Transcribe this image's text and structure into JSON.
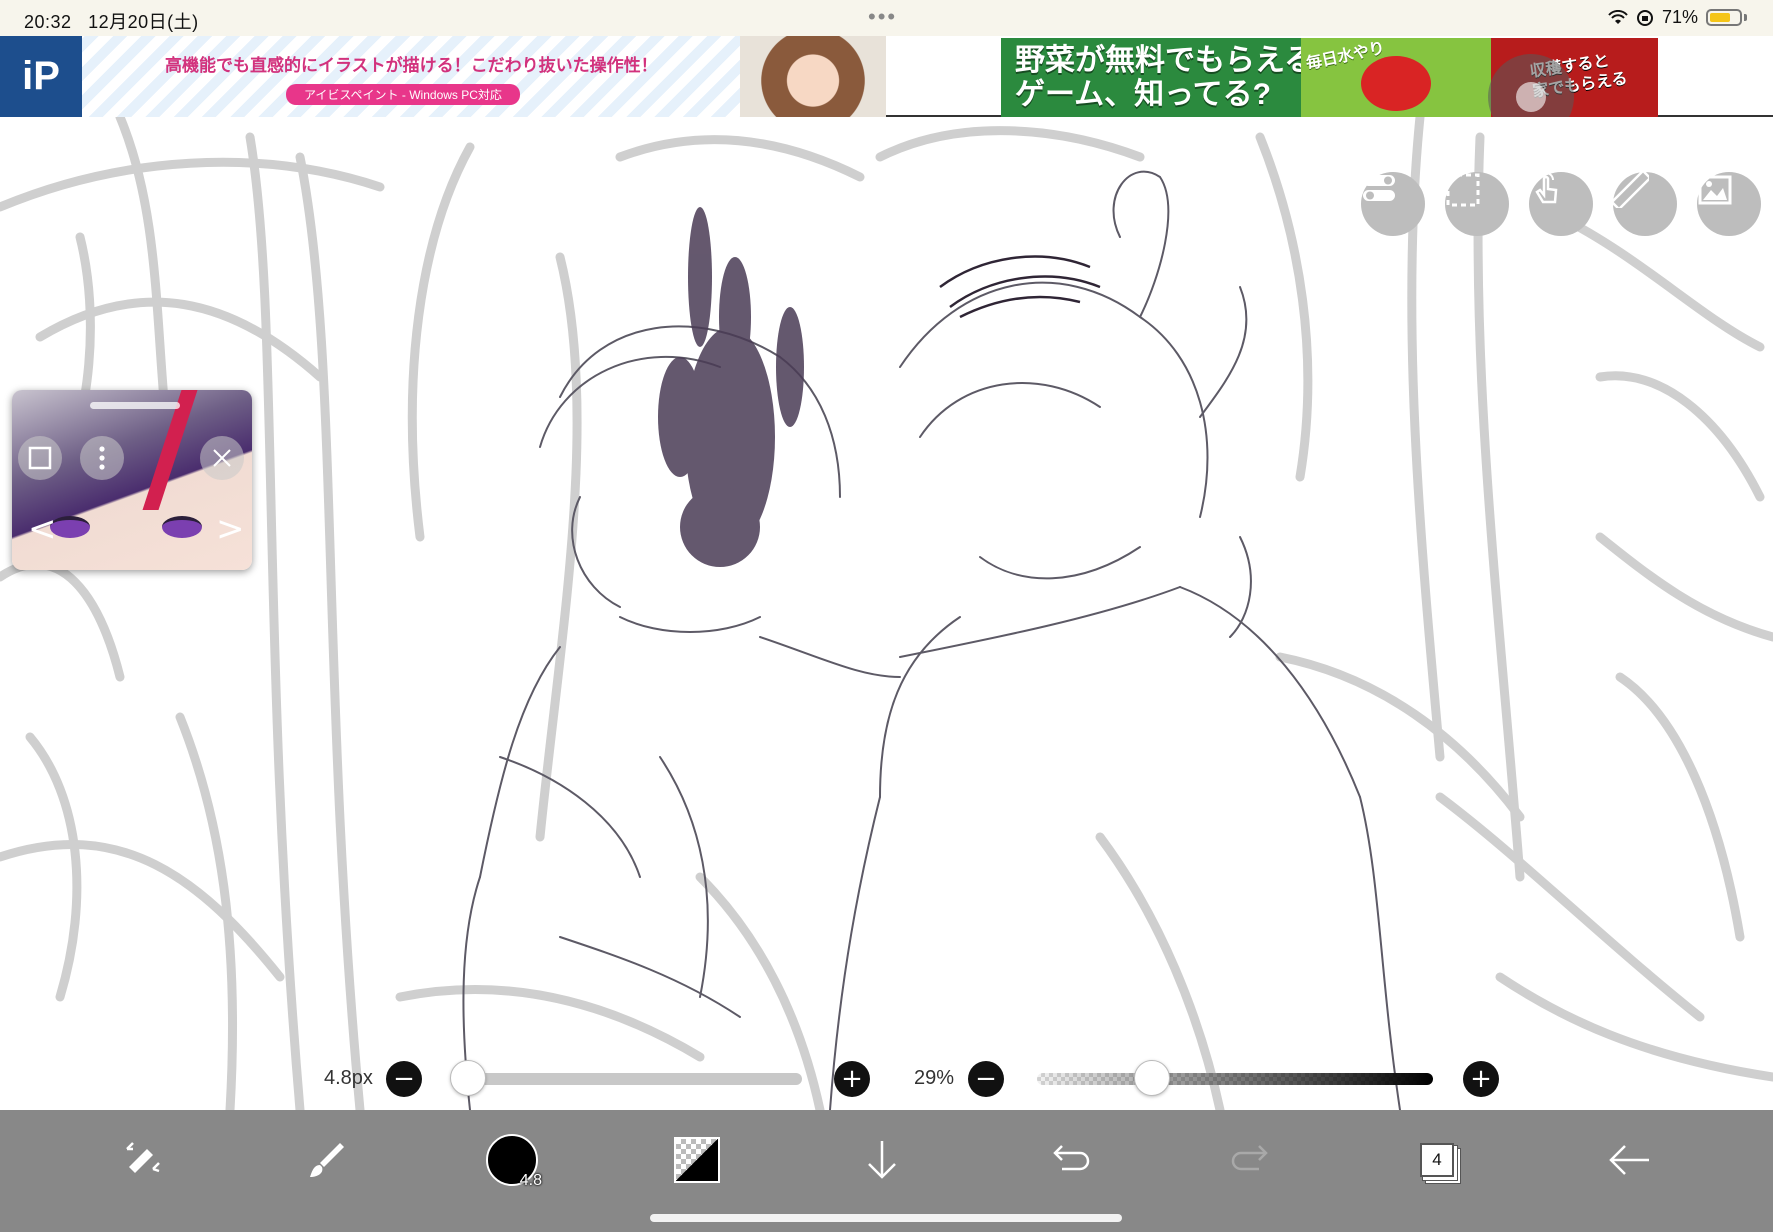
{
  "status_bar": {
    "time": "20:32",
    "date": "12月20日(土)",
    "dots": "•••",
    "battery_text": "71%",
    "battery_level": 0.71,
    "battery_color": "#f5c518"
  },
  "ads": {
    "left": {
      "logo": "iP",
      "title": "高機能でも直感的にイラストが描ける！こだわり抜いた操作性！",
      "subtitle": "アイビスペイント - Windows PC対応"
    },
    "right": {
      "headline": "野菜が無料でもらえる\nゲーム、知ってる?",
      "tag": "毎日水やり",
      "corner_text": "収穫すると\n家でもらえる"
    }
  },
  "canvas_tools": {
    "items": [
      "toggle-icon",
      "selection-icon",
      "hand-icon",
      "ruler-icon",
      "reference-image-icon"
    ]
  },
  "reference_window": {
    "prev_glyph": "<",
    "next_glyph": ">"
  },
  "sliders": {
    "size": {
      "label": "4.8px",
      "value": 4.8
    },
    "opacity": {
      "label": "29%",
      "value": 0.29
    },
    "minus_glyph": "−",
    "plus_glyph": "+"
  },
  "bottom_toolbar": {
    "brush_size": "4.8",
    "layer_count": "4",
    "items": [
      "transform-tool-icon",
      "brush-icon",
      "brush-size-indicator",
      "color-swatch",
      "download-arrow-icon",
      "undo-icon",
      "redo-icon",
      "layers-button",
      "back-arrow-icon"
    ]
  },
  "colors": {
    "toolbar_bg": "#888888",
    "tool_button_bg": "#bdbdbd",
    "sketch_light": "#c7c7c7",
    "sketch_dark": "#4a3b55"
  }
}
